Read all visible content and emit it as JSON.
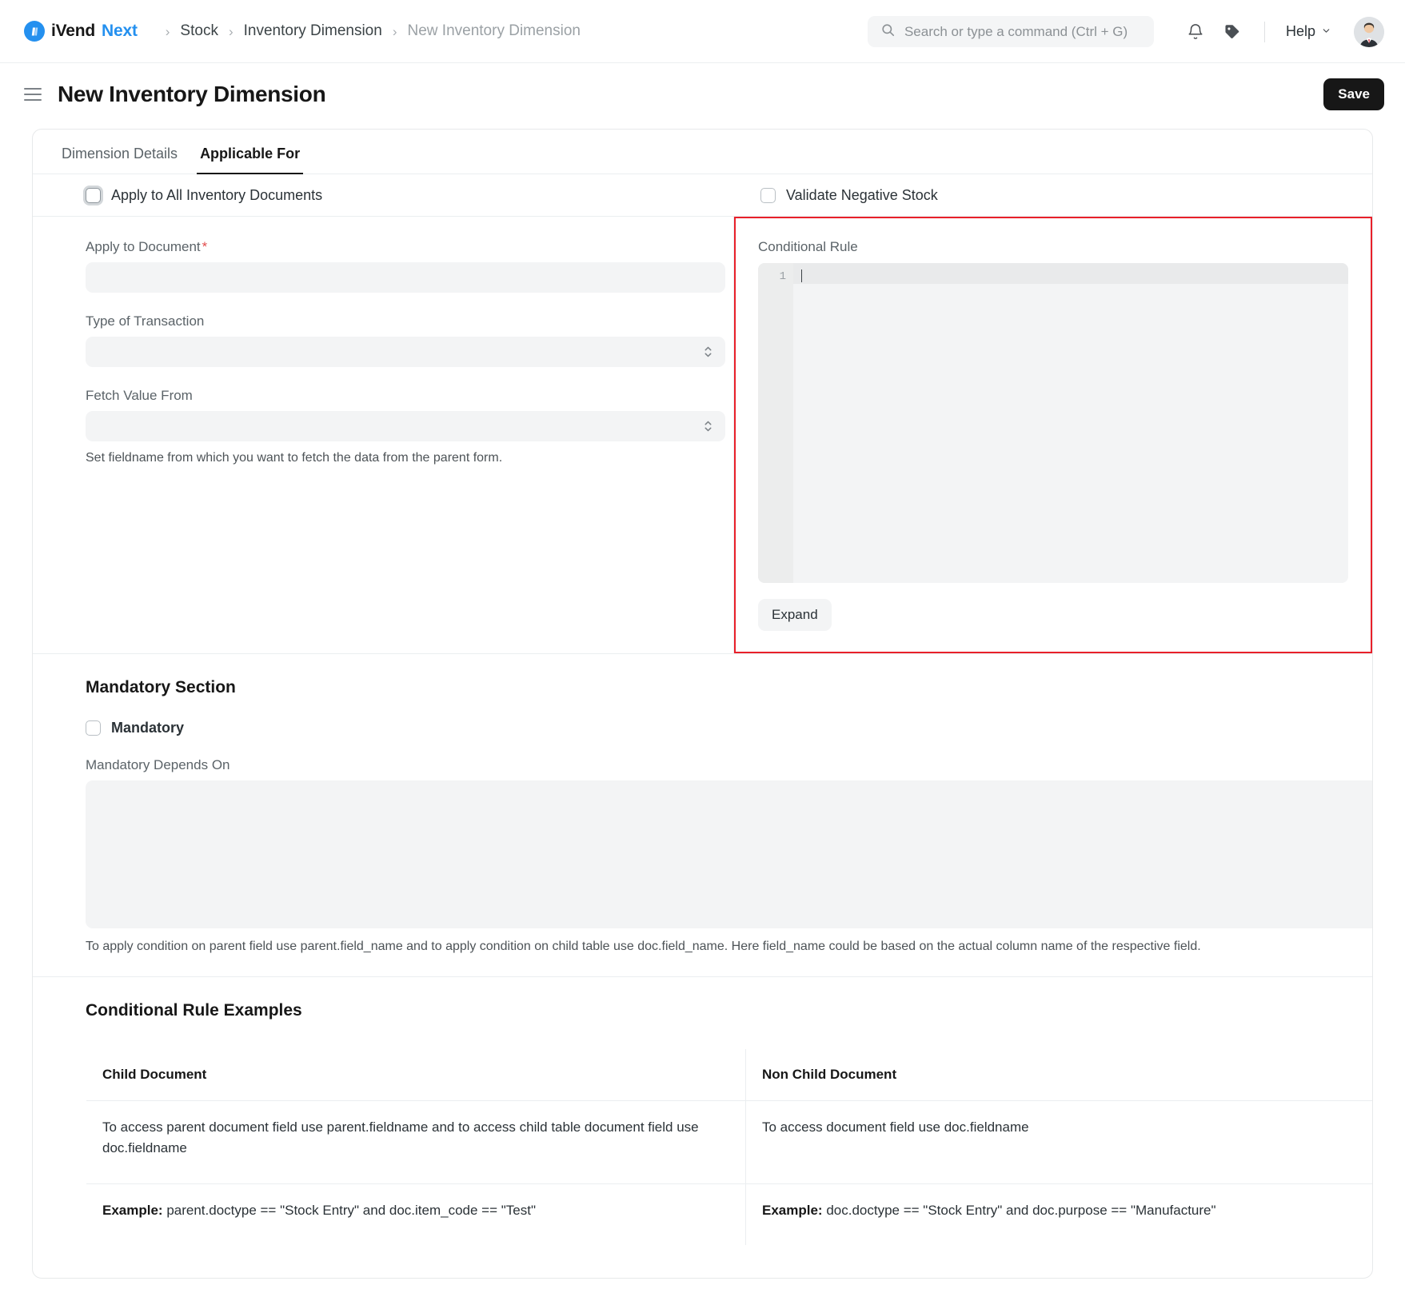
{
  "navbar": {
    "brand": {
      "first": "iVend",
      "second": "Next",
      "mark": "♨"
    },
    "breadcrumbs": [
      {
        "label": "Stock",
        "muted": false
      },
      {
        "label": "Inventory Dimension",
        "muted": false
      },
      {
        "label": "New Inventory Dimension",
        "muted": true
      }
    ],
    "separator": "›",
    "search": {
      "placeholder": "Search or type a command (Ctrl + G)",
      "value": "",
      "icon": "search-icon"
    },
    "notifications_icon": "bell-icon",
    "tag_icon": "tag-icon",
    "help": {
      "label": "Help",
      "chevron": "⌄"
    },
    "avatar": "user-avatar"
  },
  "page": {
    "title": "New Inventory Dimension",
    "menu_icon": "hamburger-icon",
    "save_label": "Save"
  },
  "tabs": [
    {
      "label": "Dimension Details",
      "active": false
    },
    {
      "label": "Applicable For",
      "active": true
    }
  ],
  "top_checks": {
    "apply_all": {
      "label": "Apply to All Inventory Documents",
      "checked": false,
      "focused": true
    },
    "validate_negative": {
      "label": "Validate Negative Stock",
      "checked": false,
      "focused": false
    }
  },
  "form": {
    "apply_to_document": {
      "label": "Apply to Document",
      "required_mark": "*",
      "value": "",
      "placeholder": ""
    },
    "type_of_transaction": {
      "label": "Type of Transaction",
      "value": "",
      "options": []
    },
    "fetch_value_from": {
      "label": "Fetch Value From",
      "value": "",
      "options": []
    },
    "fetch_value_help": "Set fieldname from which you want to fetch the data from the parent form."
  },
  "conditional_rule": {
    "label": "Conditional Rule",
    "line_number": "1",
    "code": "",
    "expand_label": "Expand",
    "highlight_color": "#e8202a"
  },
  "mandatory_section": {
    "title": "Mandatory Section",
    "mandatory_checkbox": {
      "label": "Mandatory",
      "checked": false
    },
    "depends_on": {
      "label": "Mandatory Depends On",
      "value": "",
      "placeholder": ""
    },
    "help": "To apply condition on parent field use parent.field_name and to apply condition on child table use doc.field_name. Here field_name could be based on the actual column name of the respective field."
  },
  "examples": {
    "title": "Conditional Rule Examples",
    "headers": [
      "Child Document",
      "Non Child Document"
    ],
    "rows": [
      {
        "child": "To access parent document field use parent.fieldname and to access child table document field use doc.fieldname",
        "non_child": "To access document field use doc.fieldname"
      },
      {
        "child_prefix": "Example:",
        "child": " parent.doctype == \"Stock Entry\" and doc.item_code == \"Test\"",
        "non_child_prefix": "Example:",
        "non_child": " doc.doctype == \"Stock Entry\" and doc.purpose == \"Manufacture\""
      }
    ]
  }
}
